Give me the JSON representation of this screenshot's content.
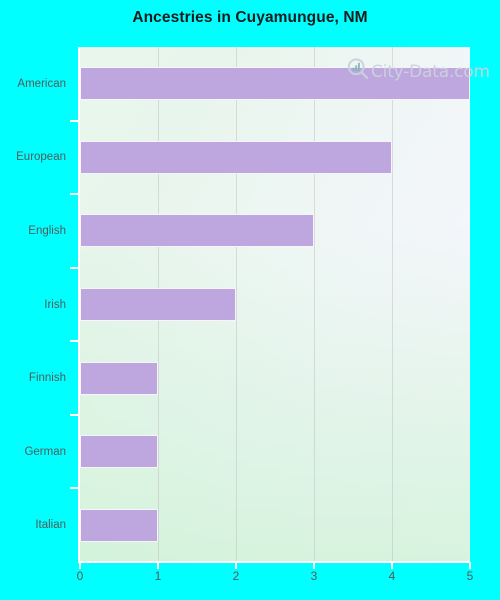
{
  "chart_data": {
    "type": "bar",
    "orientation": "horizontal",
    "title": "Ancestries in Cuyamungue, NM",
    "xlabel": "",
    "ylabel": "",
    "categories": [
      "American",
      "European",
      "English",
      "Irish",
      "Finnish",
      "German",
      "Italian"
    ],
    "values": [
      5,
      4,
      3,
      2,
      1,
      1,
      1
    ],
    "xlim": [
      0,
      5
    ],
    "xticks": [
      "0",
      "1",
      "2",
      "3",
      "4",
      "5"
    ],
    "xtick_values": [
      0,
      1,
      2,
      3,
      4,
      5
    ],
    "grid": "vertical",
    "legend": "none",
    "bar_color": "#bda7de",
    "bar_border_color": "#f7f4fb"
  },
  "colors": {
    "page_background": "#00ffff",
    "title_text": "#1b1b1b",
    "tick_text": "#4f5b5b",
    "axis_line": "#ffffff",
    "gridline": "#bababa",
    "plot_left": "#e9f6ec",
    "plot_right": "#f4f6fa",
    "watermark_text": "#ccd3dd"
  },
  "watermark": {
    "text": "City-Data.com",
    "icon": "magnifier-barchart-icon"
  }
}
